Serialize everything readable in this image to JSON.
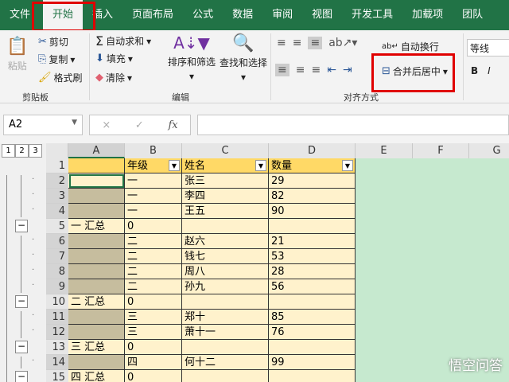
{
  "tabs": [
    "文件",
    "开始",
    "插入",
    "页面布局",
    "公式",
    "数据",
    "审阅",
    "视图",
    "开发工具",
    "加载项",
    "团队"
  ],
  "ribbon": {
    "paste": "粘贴",
    "cut": "剪切",
    "copy": "复制",
    "format_painter": "格式刷",
    "group_clipboard": "剪贴板",
    "autosum": "自动求和",
    "fill": "填充",
    "clear": "清除",
    "sort_filter": "排序和筛选",
    "find_select": "查找和选择",
    "group_edit": "编辑",
    "wrap_text": "自动换行",
    "merge_center": "合并后居中",
    "group_align": "对齐方式",
    "font_name": "等线",
    "bold": "B",
    "italic": "I"
  },
  "formula_bar": {
    "name_box": "A2",
    "cancel": "×",
    "enter": "✓",
    "fx": "fx",
    "value": ""
  },
  "outline_levels": [
    "1",
    "2",
    "3"
  ],
  "columns": [
    "A",
    "B",
    "C",
    "D",
    "E",
    "F",
    "G"
  ],
  "rows": [
    {
      "n": "1",
      "a": "",
      "b": "年级",
      "c": "姓名",
      "d": "数量",
      "type": "header"
    },
    {
      "n": "2",
      "a": "",
      "b": "一",
      "c": "张三",
      "d": "29",
      "type": "detail"
    },
    {
      "n": "3",
      "a": "",
      "b": "一",
      "c": "李四",
      "d": "82",
      "type": "detail"
    },
    {
      "n": "4",
      "a": "",
      "b": "一",
      "c": "王五",
      "d": "90",
      "type": "detail"
    },
    {
      "n": "5",
      "a": "一 汇总",
      "b": "0",
      "c": "",
      "d": "",
      "type": "total"
    },
    {
      "n": "6",
      "a": "",
      "b": "二",
      "c": "赵六",
      "d": "21",
      "type": "detail"
    },
    {
      "n": "7",
      "a": "",
      "b": "二",
      "c": "钱七",
      "d": "53",
      "type": "detail"
    },
    {
      "n": "8",
      "a": "",
      "b": "二",
      "c": "周八",
      "d": "28",
      "type": "detail"
    },
    {
      "n": "9",
      "a": "",
      "b": "二",
      "c": "孙九",
      "d": "56",
      "type": "detail"
    },
    {
      "n": "10",
      "a": "二 汇总",
      "b": "0",
      "c": "",
      "d": "",
      "type": "total"
    },
    {
      "n": "11",
      "a": "",
      "b": "三",
      "c": "郑十",
      "d": "85",
      "type": "detail"
    },
    {
      "n": "12",
      "a": "",
      "b": "三",
      "c": "萧十一",
      "d": "76",
      "type": "detail"
    },
    {
      "n": "13",
      "a": "三 汇总",
      "b": "0",
      "c": "",
      "d": "",
      "type": "total"
    },
    {
      "n": "14",
      "a": "",
      "b": "四",
      "c": "何十二",
      "d": "99",
      "type": "detail"
    },
    {
      "n": "15",
      "a": "四 汇总",
      "b": "0",
      "c": "",
      "d": "",
      "type": "total"
    }
  ],
  "watermark": "悟空问答"
}
